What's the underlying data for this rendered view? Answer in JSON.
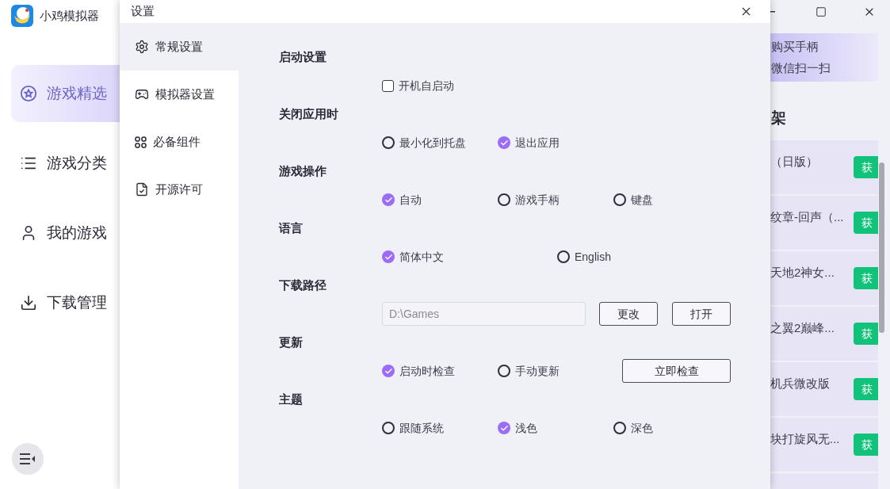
{
  "app": {
    "title": "小鸡模拟器"
  },
  "sidebar": {
    "items": [
      {
        "label": "游戏精选",
        "selected": true
      },
      {
        "label": "游戏分类",
        "selected": false
      },
      {
        "label": "我的游戏",
        "selected": false
      },
      {
        "label": "下载管理",
        "selected": false
      }
    ]
  },
  "dialog": {
    "title": "设置",
    "nav": [
      {
        "label": "常规设置",
        "selected": true
      },
      {
        "label": "模拟器设置",
        "selected": false
      },
      {
        "label": "必备组件",
        "selected": false
      },
      {
        "label": "开源许可",
        "selected": false
      }
    ],
    "sections": [
      {
        "title": "启动设置",
        "options": [
          {
            "kind": "checkbox",
            "label": "开机自启动",
            "checked": false
          }
        ]
      },
      {
        "title": "关闭应用时",
        "options": [
          {
            "kind": "radio",
            "label": "最小化到托盘",
            "selected": false
          },
          {
            "kind": "radio",
            "label": "退出应用",
            "selected": true
          }
        ]
      },
      {
        "title": "游戏操作",
        "options": [
          {
            "kind": "radio",
            "label": "自动",
            "selected": true
          },
          {
            "kind": "radio",
            "label": "游戏手柄",
            "selected": false
          },
          {
            "kind": "radio",
            "label": "键盘",
            "selected": false
          }
        ]
      },
      {
        "title": "语言",
        "options": [
          {
            "kind": "radio",
            "label": "简体中文",
            "selected": true
          },
          {
            "kind": "radio",
            "label": "English",
            "selected": false
          }
        ]
      },
      {
        "title": "下载路径",
        "path_field": {
          "value": "D:\\Games"
        },
        "buttons": [
          "更改",
          "打开"
        ]
      },
      {
        "title": "更新",
        "options": [
          {
            "kind": "radio",
            "label": "启动时检查",
            "selected": true
          },
          {
            "kind": "radio",
            "label": "手动更新",
            "selected": false
          }
        ],
        "buttons": [
          "立即检查"
        ]
      },
      {
        "title": "主题",
        "options": [
          {
            "kind": "radio",
            "label": "跟随系统",
            "selected": false
          },
          {
            "kind": "radio",
            "label": "浅色",
            "selected": true
          },
          {
            "kind": "radio",
            "label": "深色",
            "selected": false
          }
        ]
      }
    ]
  },
  "banner": {
    "lines": [
      "购买手柄",
      "微信扫一扫"
    ]
  },
  "shelf": {
    "heading": "架",
    "items": [
      {
        "name": "（日版）",
        "button": "获"
      },
      {
        "name": "纹章-回声（...",
        "button": "获"
      },
      {
        "name": "天地2神女...",
        "button": "获"
      },
      {
        "name": "之翼2巅峰...",
        "button": "获"
      },
      {
        "name": "机兵微改版",
        "button": "获"
      },
      {
        "name": "块打旋风无...",
        "button": "获"
      }
    ]
  }
}
